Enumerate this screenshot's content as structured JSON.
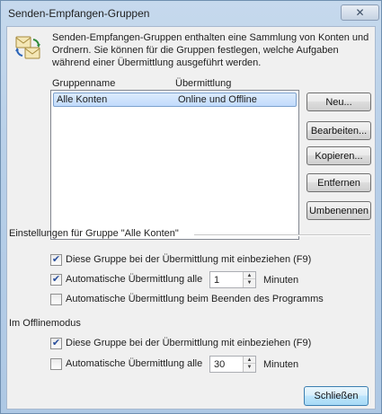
{
  "window": {
    "title": "Senden-Empfangen-Gruppen",
    "close_glyph": "✕"
  },
  "intro_text": "Senden-Empfangen-Gruppen enthalten eine Sammlung von Konten und Ordnern. Sie können für die Gruppen festlegen, welche Aufgaben während einer Übermittlung ausgeführt werden.",
  "icon": "send-receive-groups-icon",
  "groups_list": {
    "columns": [
      "Gruppenname",
      "Übermittlung"
    ],
    "rows": [
      {
        "name": "Alle Konten",
        "transfer": "Online und Offline",
        "selected": true
      }
    ]
  },
  "buttons": {
    "new": "Neu...",
    "edit": "Bearbeiten...",
    "copy": "Kopieren...",
    "remove": "Entfernen",
    "rename": "Umbenennen",
    "close": "Schließen"
  },
  "settings_section": {
    "title": "Einstellungen für Gruppe \"Alle Konten\"",
    "include_in_send_receive": {
      "label": "Diese Gruppe bei der Übermittlung mit einbeziehen (F9)",
      "checked": true
    },
    "auto_send_receive": {
      "label": "Automatische Übermittlung alle",
      "checked": true,
      "value": "1",
      "unit": "Minuten"
    },
    "auto_on_exit": {
      "label": "Automatische Übermittlung beim Beenden des Programms",
      "checked": false
    }
  },
  "offline_section": {
    "title": "Im Offlinemodus",
    "include_in_send_receive": {
      "label": "Diese Gruppe bei der Übermittlung mit einbeziehen (F9)",
      "checked": true
    },
    "auto_send_receive": {
      "label": "Automatische Übermittlung alle",
      "checked": false,
      "value": "30",
      "unit": "Minuten"
    }
  },
  "checkmark_glyph": "✔",
  "colors": {
    "selection": "#c1dbfc",
    "title_bar": "#b7cfe8",
    "default_button": "#bee6fd"
  }
}
